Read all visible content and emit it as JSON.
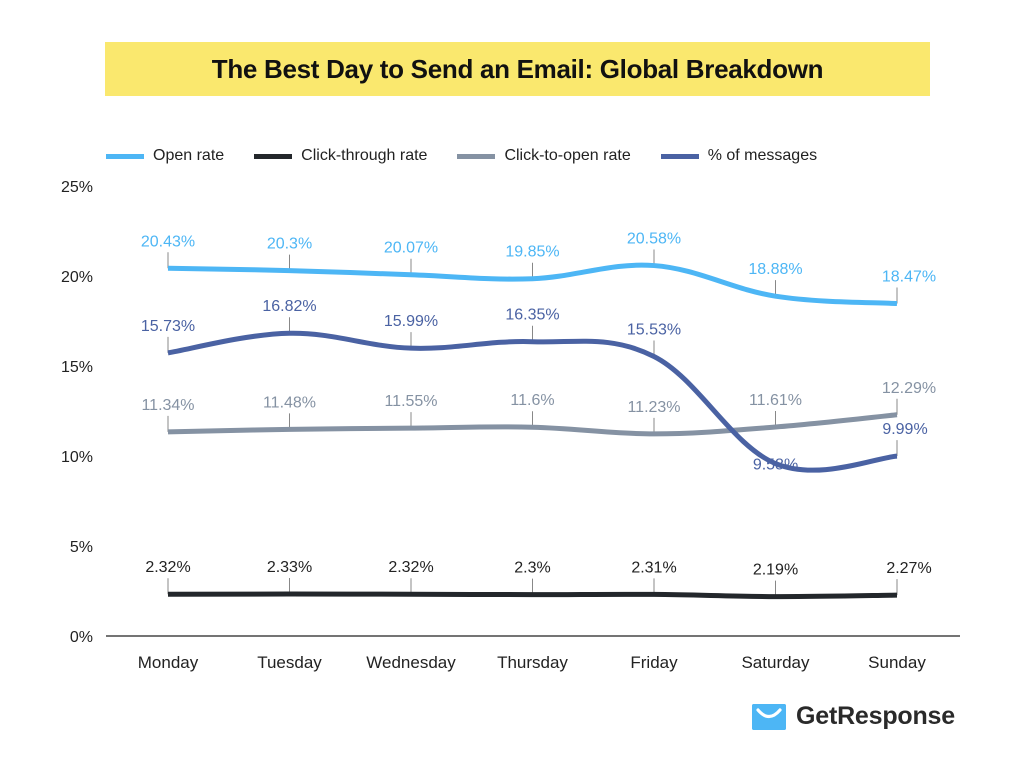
{
  "header": {
    "title": "The Best Day to Send an Email: Global Breakdown"
  },
  "brand": {
    "name": "GetResponse",
    "logo_icon": "envelope-smile-icon"
  },
  "chart_data": {
    "type": "line",
    "title": "The Best Day to Send an Email: Global Breakdown",
    "xlabel": "",
    "ylabel": "",
    "categories": [
      "Monday",
      "Tuesday",
      "Wednesday",
      "Thursday",
      "Friday",
      "Saturday",
      "Sunday"
    ],
    "ylim": [
      0,
      25
    ],
    "yticks": [
      0,
      5,
      10,
      15,
      20,
      25
    ],
    "ytick_labels": [
      "0%",
      "5%",
      "10%",
      "15%",
      "20%",
      "25%"
    ],
    "grid": false,
    "legend_position": "top-left",
    "series": [
      {
        "name": "Open rate",
        "color": "#4db6f5",
        "values": [
          20.43,
          20.3,
          20.07,
          19.85,
          20.58,
          18.88,
          18.47
        ],
        "labels": [
          "20.43%",
          "20.3%",
          "20.07%",
          "19.85%",
          "20.58%",
          "18.88%",
          "18.47%"
        ]
      },
      {
        "name": "Click-through rate",
        "color": "#23272b",
        "values": [
          2.32,
          2.33,
          2.32,
          2.3,
          2.31,
          2.19,
          2.27
        ],
        "labels": [
          "2.32%",
          "2.33%",
          "2.32%",
          "2.3%",
          "2.31%",
          "2.19%",
          "2.27%"
        ]
      },
      {
        "name": "Click-to-open rate",
        "color": "#8592a3",
        "values": [
          11.34,
          11.48,
          11.55,
          11.6,
          11.23,
          11.61,
          12.29
        ],
        "labels": [
          "11.34%",
          "11.48%",
          "11.55%",
          "11.6%",
          "11.23%",
          "11.61%",
          "12.29%"
        ]
      },
      {
        "name": "% of messages",
        "color": "#4a62a3",
        "values": [
          15.73,
          16.82,
          15.99,
          16.35,
          15.53,
          9.58,
          9.99
        ],
        "labels": [
          "15.73%",
          "16.82%",
          "15.99%",
          "16.35%",
          "15.53%",
          "9.58%",
          "9.99%"
        ]
      }
    ]
  }
}
